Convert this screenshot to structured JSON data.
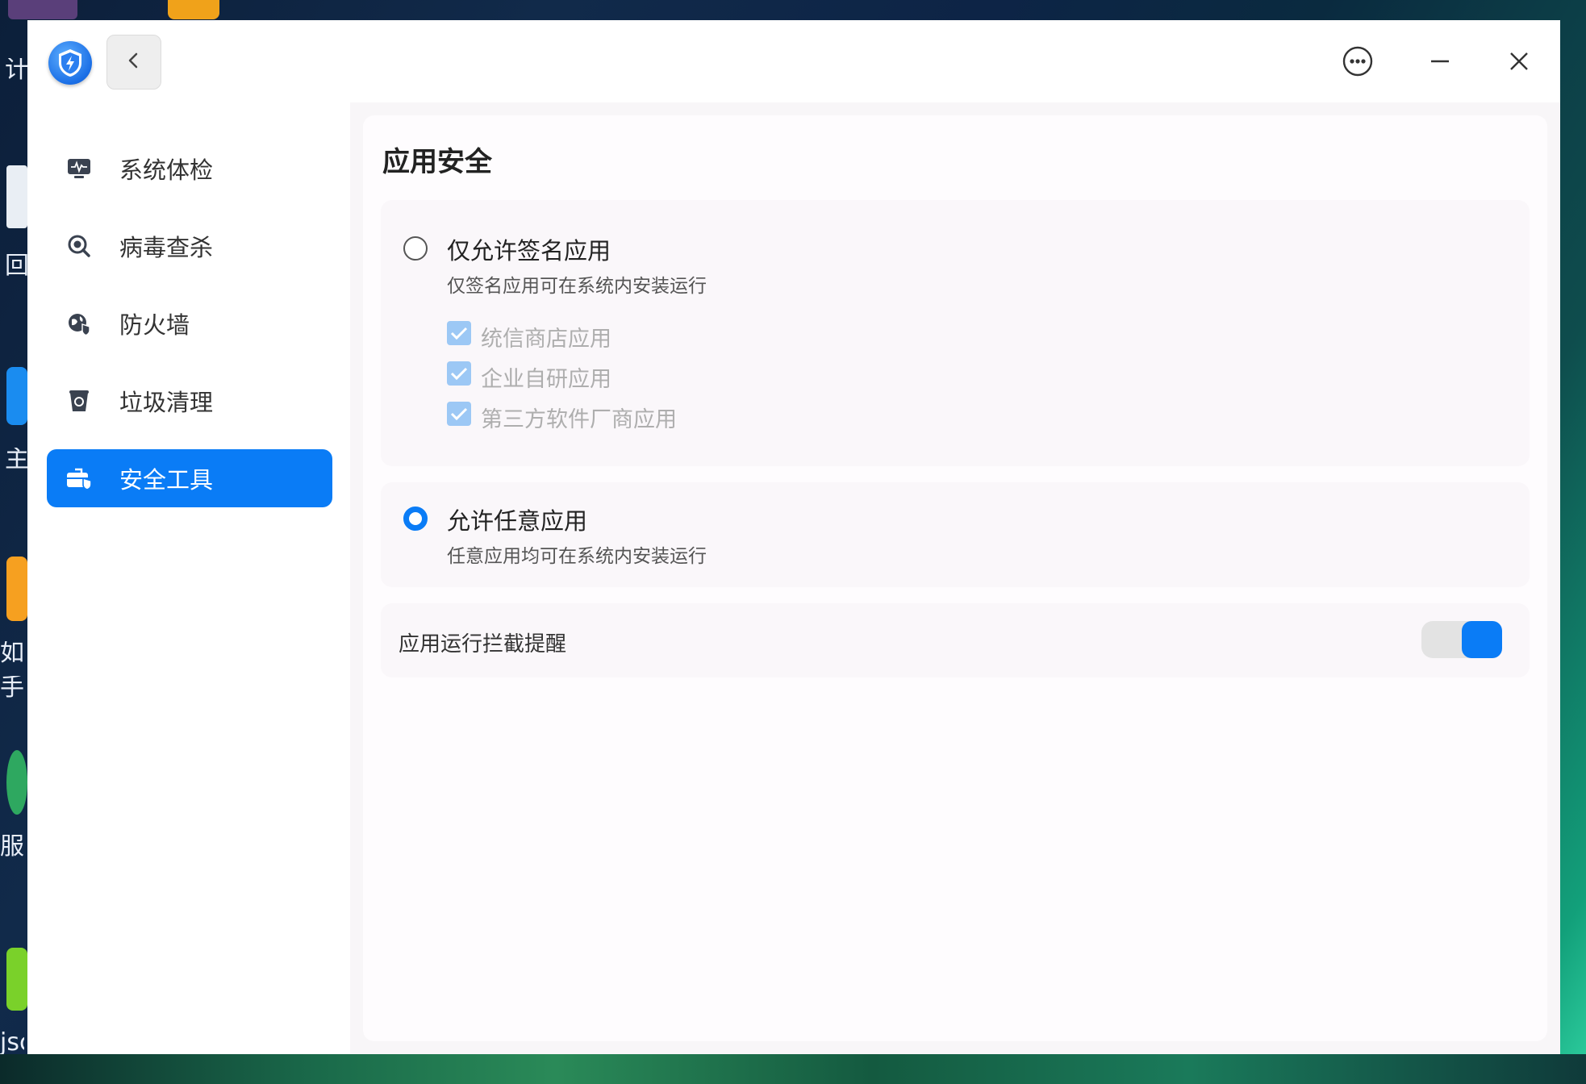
{
  "desktop": {
    "labels": [
      "计",
      "回",
      "主",
      "如何",
      "手统",
      "服务",
      "jsc"
    ]
  },
  "window": {
    "back_icon": "chevron-left-icon",
    "menu_icon": "more-options-icon",
    "minimize_icon": "minimize-icon",
    "close_icon": "close-icon"
  },
  "sidebar": {
    "items": [
      {
        "label": "系统体检",
        "icon": "monitor-pulse-icon"
      },
      {
        "label": "病毒查杀",
        "icon": "virus-scan-icon"
      },
      {
        "label": "防火墙",
        "icon": "firewall-icon"
      },
      {
        "label": "垃圾清理",
        "icon": "trash-icon"
      },
      {
        "label": "安全工具",
        "icon": "toolbox-icon",
        "active": true
      }
    ]
  },
  "main": {
    "title": "应用安全",
    "option_signed": {
      "title": "仅允许签名应用",
      "desc": "仅签名应用可在系统内安装运行",
      "selected": false,
      "sub_options": [
        {
          "label": "统信商店应用",
          "checked": true,
          "disabled": true
        },
        {
          "label": "企业自研应用",
          "checked": true,
          "disabled": true
        },
        {
          "label": "第三方软件厂商应用",
          "checked": true,
          "disabled": true
        }
      ]
    },
    "option_any": {
      "title": "允许任意应用",
      "desc": "任意应用均可在系统内安装运行",
      "selected": true
    },
    "intercept": {
      "label": "应用运行拦截提醒",
      "enabled": true
    }
  },
  "colors": {
    "accent": "#0a7cf6"
  }
}
